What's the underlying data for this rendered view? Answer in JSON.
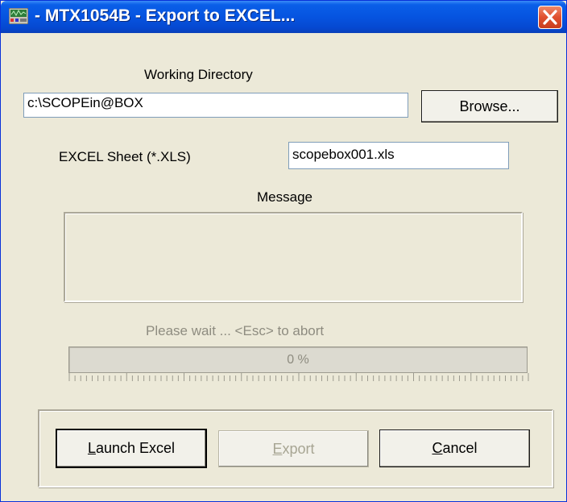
{
  "window": {
    "title": "- MTX1054B - Export to EXCEL...",
    "app_icon": "oscilloscope-app-icon",
    "close_icon": "close-icon",
    "colors": {
      "titlebar": "#0654E0",
      "close": "#E0502E",
      "face": "#ECE9D8"
    }
  },
  "working_directory": {
    "label": "Working Directory",
    "value": "c:\\SCOPEin@BOX",
    "browse_label": "Browse..."
  },
  "excel_sheet": {
    "label": "EXCEL Sheet (*.XLS)",
    "value": "scopebox001.xls"
  },
  "message": {
    "label": "Message",
    "text": ""
  },
  "progress": {
    "label": "Please wait ... <Esc> to abort",
    "percent_text": "0 %",
    "value": 0
  },
  "buttons": {
    "launch_excel": {
      "mnemonic": "L",
      "rest": "aunch Excel"
    },
    "export": {
      "mnemonic": "E",
      "rest": "xport"
    },
    "cancel": {
      "mnemonic": "C",
      "rest": "ancel"
    }
  }
}
